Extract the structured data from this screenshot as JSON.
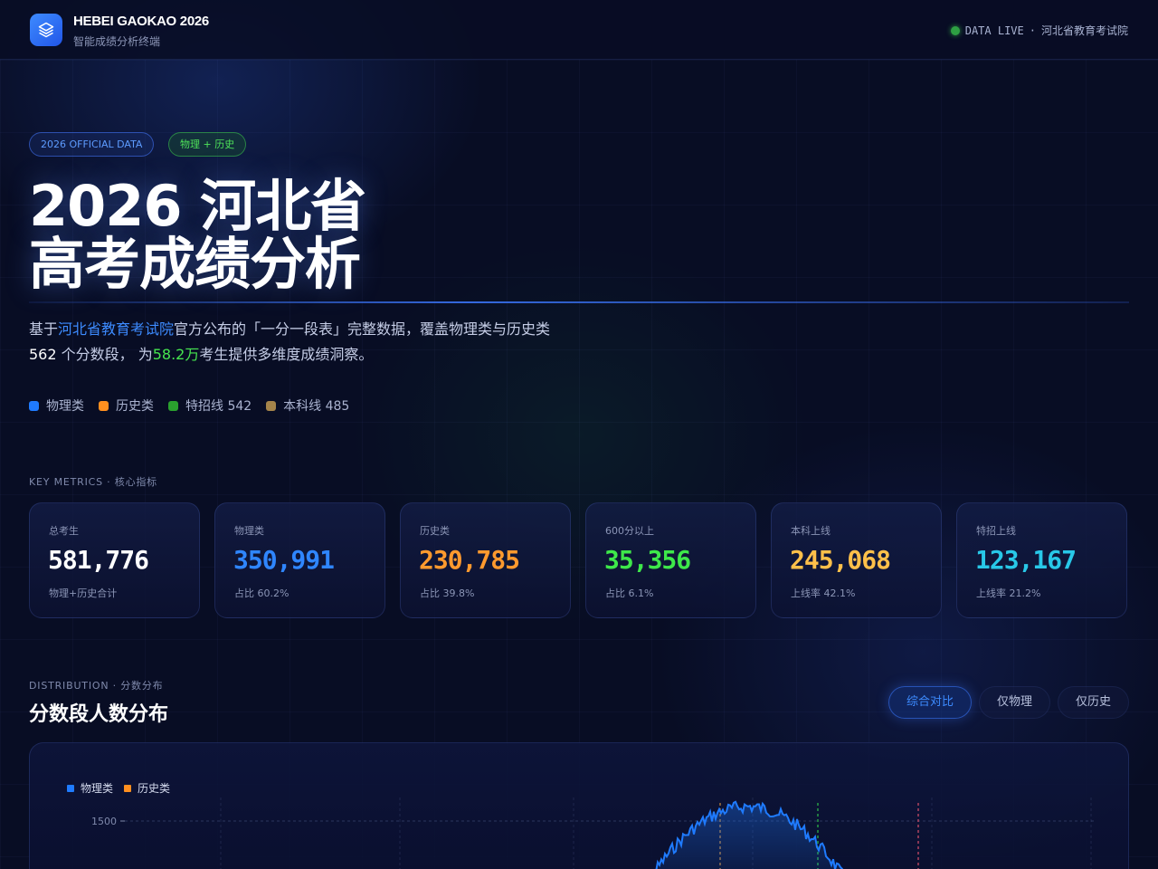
{
  "header": {
    "brand_title": "HEBEI GAOKAO 2026",
    "brand_subtitle": "智能成绩分析终端",
    "live_label": "DATA LIVE",
    "live_separator": "·",
    "live_source": "河北省教育考试院"
  },
  "hero": {
    "pill_official": "2026 OFFICIAL DATA",
    "pill_subjects": "物理 + 历史",
    "title_line1": "2026 河北省",
    "title_line2": "高考成绩分析",
    "desc_1": "基于",
    "desc_source": "河北省教育考试院",
    "desc_2": "官方公布的「一分一段表」完整数据，覆盖物理类与历史类",
    "desc_count": "562",
    "desc_3": " 个分数段， 为",
    "desc_total": "58.2万",
    "desc_4": "考生提供多维度成绩洞察。",
    "legend": [
      {
        "label": "物理类",
        "color": "#1f7bff"
      },
      {
        "label": "历史类",
        "color": "#ff8f1f"
      },
      {
        "label": "特招线 542",
        "color": "#2aa02e"
      },
      {
        "label": "本科线 485",
        "color": "#a5844a"
      }
    ]
  },
  "metrics": {
    "section_label": "KEY METRICS · 核心指标",
    "cards": [
      {
        "label": "总考生",
        "value": "581,776",
        "sub": "物理+历史合计",
        "color": "#ffffff"
      },
      {
        "label": "物理类",
        "value": "350,991",
        "sub": "占比 60.2%",
        "color": "#2f86ff"
      },
      {
        "label": "历史类",
        "value": "230,785",
        "sub": "占比 39.8%",
        "color": "#ff9a2e"
      },
      {
        "label": "600分以上",
        "value": "35,356",
        "sub": "占比 6.1%",
        "color": "#3ee84a"
      },
      {
        "label": "本科上线",
        "value": "245,068",
        "sub": "上线率 42.1%",
        "color": "#ffc04a"
      },
      {
        "label": "特招上线",
        "value": "123,167",
        "sub": "上线率 21.2%",
        "color": "#28c8e8"
      }
    ]
  },
  "distribution": {
    "section_label": "DISTRIBUTION · 分数分布",
    "title": "分数段人数分布",
    "tabs": [
      "综合对比",
      "仅物理",
      "仅历史"
    ],
    "active_tab": 0
  },
  "chart_data": {
    "type": "area",
    "series": [
      {
        "name": "物理类",
        "color": "#1f7bff"
      },
      {
        "name": "历史类",
        "color": "#ff8f1f"
      }
    ],
    "y_tick_visible": "1500",
    "grid": true,
    "legend_position": "top-left",
    "note": "Only the top of the distribution peak is visible; values near peak ≈ 1200–1650 per score"
  }
}
